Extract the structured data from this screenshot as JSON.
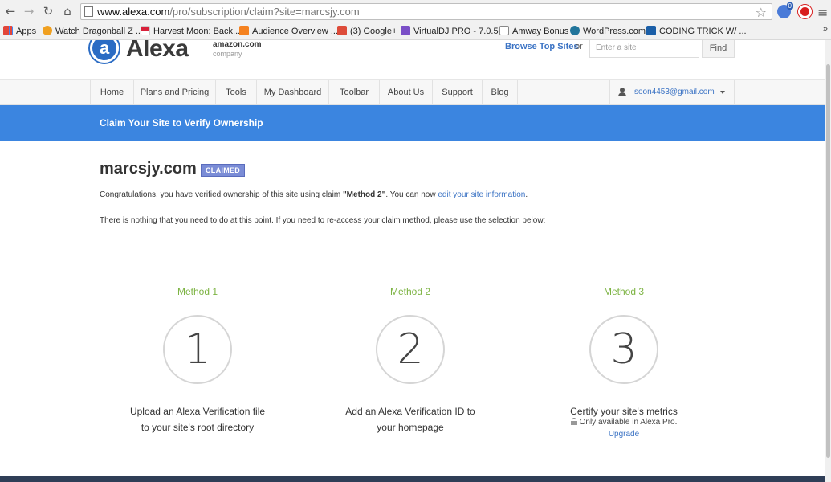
{
  "browser": {
    "url_host": "www.alexa.com",
    "url_path": "/pro/subscription/claim?site=marcsjy.com",
    "extension_badge": "0",
    "bookmarks": [
      {
        "label": "Apps",
        "color": "#e2463a"
      },
      {
        "label": "Watch Dragonball Z ...",
        "color": "#f0a020"
      },
      {
        "label": "Harvest Moon: Back...",
        "color": "#d8203a"
      },
      {
        "label": "Audience Overview ...",
        "color": "#f58220"
      },
      {
        "label": "(3) Google+",
        "color": "#dd4b39"
      },
      {
        "label": "VirtualDJ PRO - 7.0.5...",
        "color": "#7a4fc7"
      },
      {
        "label": "Amway Bonus",
        "color": "#ffffff"
      },
      {
        "label": "WordPress.com",
        "color": "#21759b"
      },
      {
        "label": "CODING TRICK W/ ...",
        "color": "#1b5fa8"
      }
    ],
    "more": "»"
  },
  "header": {
    "logo_mark": "a",
    "logo_text": "Alexa",
    "amazon_text": "amazon.com",
    "amazon_sub": "company",
    "browse_link": "Browse Top Sites",
    "or_text": "or",
    "search_placeholder": "Enter a site",
    "find_label": "Find"
  },
  "nav": {
    "items": [
      "Home",
      "Plans and Pricing",
      "Tools",
      "My Dashboard",
      "Toolbar",
      "About Us",
      "Support",
      "Blog"
    ],
    "user_email": "soon4453@gmail.com"
  },
  "banner": {
    "title": "Claim Your Site to Verify Ownership"
  },
  "main": {
    "site_name": "marcsjy.com",
    "badge": "CLAIMED",
    "para1_prefix": "Congratulations, you have verified ownership of this site using claim ",
    "para1_method": "\"Method 2\"",
    "para1_middle": ". You can now ",
    "para1_link": "edit your site information",
    "para1_suffix": ".",
    "para2": "There is nothing that you need to do at this point. If you need to re-access your claim method, please use the selection below:",
    "methods": [
      {
        "title": "Method 1",
        "number": "1",
        "line1": "Upload an Alexa Verification file",
        "line2": "to your site's root directory"
      },
      {
        "title": "Method 2",
        "number": "2",
        "line1": "Add an Alexa Verification ID to",
        "line2": "your homepage"
      },
      {
        "title": "Method 3",
        "number": "3",
        "line1": "Certify your site's metrics",
        "note": "Only available in Alexa Pro.",
        "link": "Upgrade"
      }
    ]
  },
  "colors": {
    "accent_blue": "#3b85e0",
    "method_green": "#7cb342",
    "link_blue": "#3b73c4",
    "badge_purple": "#7a8cd6"
  }
}
